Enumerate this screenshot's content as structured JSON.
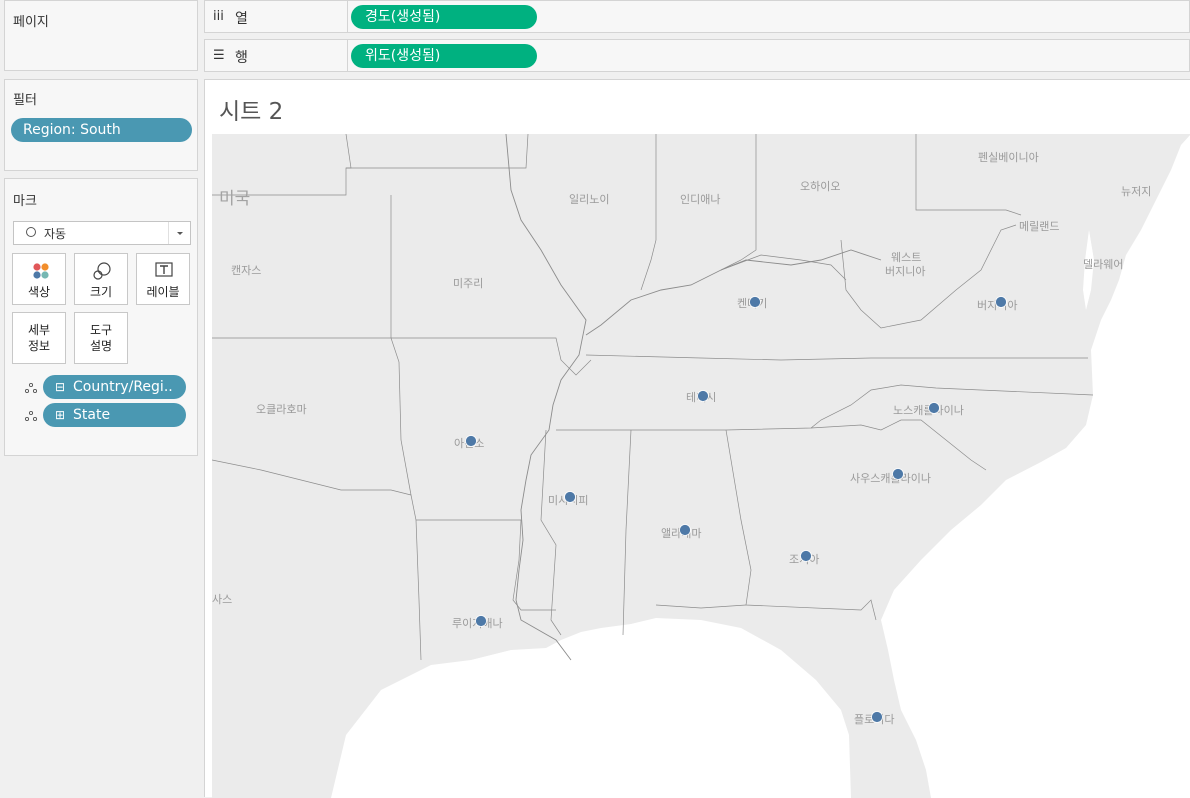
{
  "pages_panel": {
    "title": "페이지"
  },
  "columns_shelf": {
    "icon": "iii",
    "label": "열",
    "pill": "경도(생성됨)"
  },
  "rows_shelf": {
    "icon": "☰",
    "label": "행",
    "pill": "위도(생성됨)"
  },
  "filters_panel": {
    "title": "필터",
    "filter_pill": "Region: South"
  },
  "marks_panel": {
    "title": "마크",
    "mark_type": "자동",
    "buttons": [
      {
        "label": "색상",
        "icon": "color-icon"
      },
      {
        "label": "크기",
        "icon": "size-icon"
      },
      {
        "label": "레이블",
        "icon": "label-icon"
      },
      {
        "label": "세부\n정보",
        "line1": "세부",
        "line2": "정보",
        "icon": "detail-icon"
      },
      {
        "label": "도구\n설명",
        "line1": "도구",
        "line2": "설명",
        "icon": "tooltip-icon"
      }
    ],
    "fields": [
      {
        "name": "Country/Regi..",
        "toggle": "⊟"
      },
      {
        "name": "State",
        "toggle": "⊞"
      }
    ]
  },
  "sheet": {
    "title": "시트 2"
  },
  "map": {
    "background_labels": {
      "country": "미국",
      "kansas": "캔자스",
      "missouri": "미주리",
      "illinois": "일리노이",
      "indiana": "인디애나",
      "ohio": "오하이오",
      "pennsylvania": "펜실베이니아",
      "new_jersey": "뉴저지",
      "maryland": "메릴랜드",
      "delaware": "델라웨어",
      "west_virginia_1": "웨스트",
      "west_virginia_2": "버지니아",
      "oklahoma": "오클라호마",
      "texas": "사스"
    },
    "state_labels": {
      "kentucky": "켄터키",
      "virginia": "버지니아",
      "tennessee": "테네시",
      "north_carolina": "노스캐롤라이나",
      "arkansas": "아칸소",
      "south_carolina": "사우스캐롤라이나",
      "mississippi": "미시시피",
      "alabama": "앨라배마",
      "georgia": "조지아",
      "louisiana": "루이지애나",
      "florida": "플로리다"
    },
    "mark_color": "#4e79a7"
  }
}
